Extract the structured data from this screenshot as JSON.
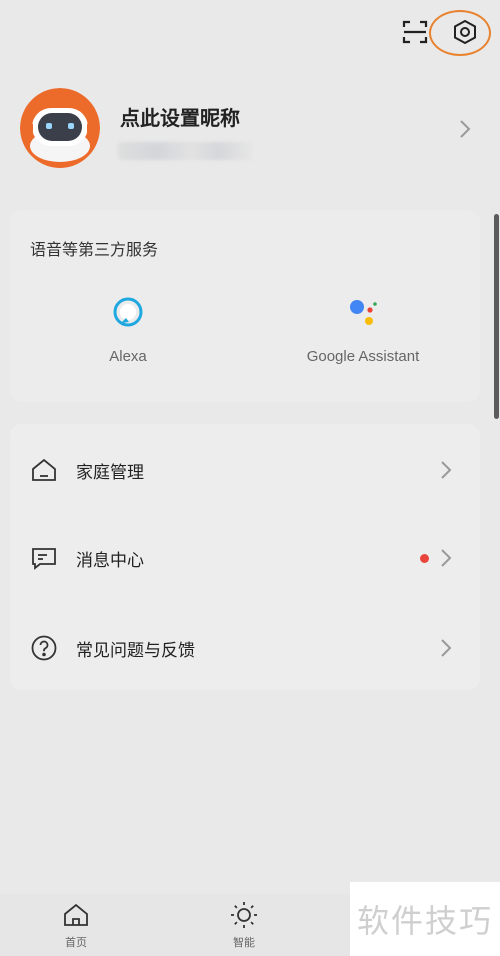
{
  "topbar": {
    "scan_icon": "scan-icon",
    "settings_icon": "settings-hexagon-icon",
    "highlight_color": "#e9822e"
  },
  "profile": {
    "nickname": "点此设置昵称",
    "avatar_icon": "robot-avatar"
  },
  "services": {
    "title": "语音等第三方服务",
    "items": [
      {
        "label": "Alexa",
        "icon": "alexa-icon"
      },
      {
        "label": "Google Assistant",
        "icon": "google-assistant-icon"
      }
    ]
  },
  "menu": {
    "items": [
      {
        "label": "家庭管理",
        "icon": "home-icon"
      },
      {
        "label": "消息中心",
        "icon": "message-icon",
        "badge_color": "#e8453c"
      },
      {
        "label": "常见问题与反馈",
        "icon": "help-icon"
      }
    ]
  },
  "bottom_nav": {
    "tabs": [
      {
        "label": "首页",
        "icon": "home-icon"
      },
      {
        "label": "智能",
        "icon": "sun-icon"
      }
    ]
  },
  "watermark": {
    "text": "软件技巧"
  }
}
